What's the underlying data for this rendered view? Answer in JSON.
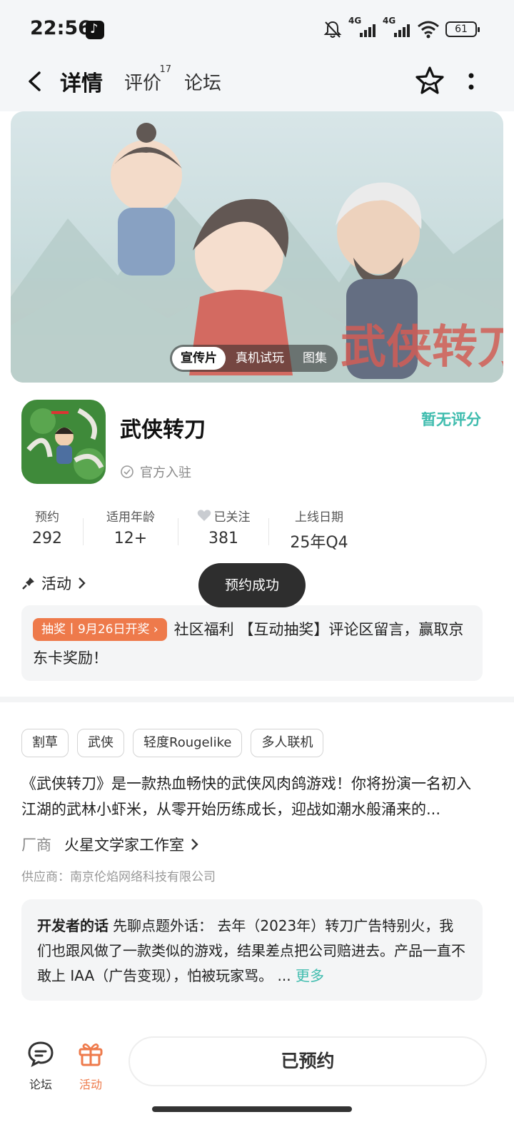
{
  "status_bar": {
    "time": "22:56",
    "network_1": "4G",
    "network_2": "4G",
    "battery": "61"
  },
  "nav": {
    "tabs": [
      {
        "label": "详情",
        "badge": ""
      },
      {
        "label": "评价",
        "badge": "17"
      },
      {
        "label": "论坛",
        "badge": ""
      }
    ]
  },
  "hero": {
    "segments": [
      "宣传片",
      "真机试玩",
      "图集"
    ],
    "active": "宣传片"
  },
  "game": {
    "name": "武侠转刀",
    "official": "官方入驻",
    "rating": "暂无评分"
  },
  "stats": [
    {
      "label": "预约",
      "value": "292"
    },
    {
      "label": "适用年龄",
      "value": "12+"
    },
    {
      "label": "已关注",
      "value": "381"
    },
    {
      "label": "上线日期",
      "value": "25年Q4"
    }
  ],
  "activity": {
    "label": "活动"
  },
  "toast": "预约成功",
  "promo": {
    "tag": "抽奖丨9月26日开奖",
    "text": "社区福利 【互动抽奖】评论区留言，赢取京东卡奖励！"
  },
  "tags": [
    "割草",
    "武侠",
    "轻度Rougelike",
    "多人联机"
  ],
  "description": "《武侠转刀》是一款热血畅快的武侠风肉鸽游戏！你将扮演一名初入江湖的武林小虾米，从零开始历练成长，迎战如潮水般涌来的...",
  "vendor": {
    "label": "厂商",
    "value": "火星文学家工作室"
  },
  "supplier": "供应商：南京伦焰网络科技有限公司",
  "developer_note": {
    "title": "开发者的话",
    "text": "先聊点题外话： 去年（2023年）转刀广告特别火，我们也跟风做了一款类似的游戏，结果差点把公司赔进去。产品一直不敢上 IAA（广告变现），怕被玩家骂。 ...",
    "more": "更多"
  },
  "bottom": {
    "forum": "论坛",
    "activity": "活动",
    "reserve": "已预约"
  },
  "colors": {
    "accent": "#3fbcae",
    "orange": "#ee7a4b"
  }
}
